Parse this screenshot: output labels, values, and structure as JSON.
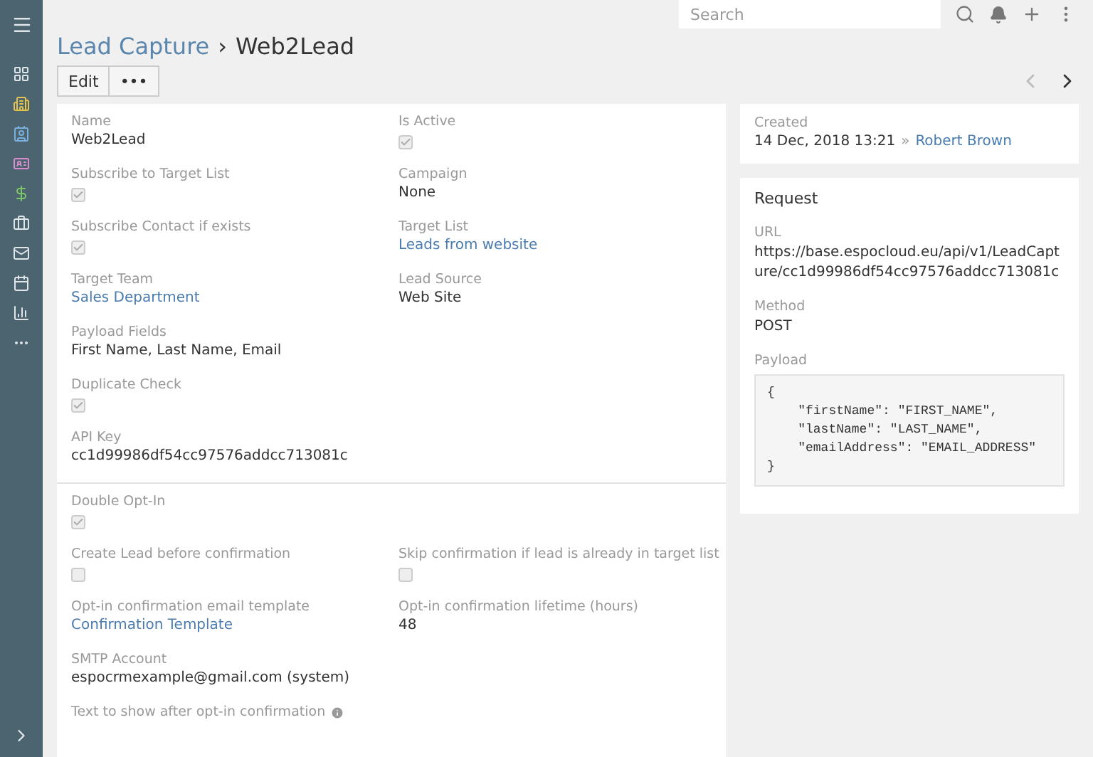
{
  "search": {
    "placeholder": "Search"
  },
  "breadcrumb": {
    "parent": "Lead Capture",
    "separator": "›",
    "current": "Web2Lead"
  },
  "actions": {
    "edit": "Edit",
    "more": "•••"
  },
  "main": {
    "sections": [
      {
        "rows": [
          {
            "fields": [
              {
                "label": "Name",
                "kind": "text",
                "value": "Web2Lead"
              },
              {
                "label": "Is Active",
                "kind": "checkbox",
                "checked": true
              }
            ]
          },
          {
            "fields": [
              {
                "label": "Subscribe to Target List",
                "kind": "checkbox",
                "checked": true
              },
              {
                "label": "Campaign",
                "kind": "text",
                "value": "None"
              }
            ]
          },
          {
            "fields": [
              {
                "label": "Subscribe Contact if exists",
                "kind": "checkbox",
                "checked": true
              },
              {
                "label": "Target List",
                "kind": "link",
                "value": "Leads from website"
              }
            ]
          },
          {
            "fields": [
              {
                "label": "Target Team",
                "kind": "link",
                "value": "Sales Department"
              },
              {
                "label": "Lead Source",
                "kind": "text",
                "value": "Web Site"
              }
            ]
          },
          {
            "fields": [
              {
                "label": "Payload Fields",
                "kind": "text",
                "value": "First Name, Last Name, Email"
              }
            ]
          },
          {
            "fields": [
              {
                "label": "Duplicate Check",
                "kind": "checkbox",
                "checked": true
              }
            ]
          },
          {
            "fields": [
              {
                "label": "API Key",
                "kind": "text",
                "value": "cc1d99986df54cc97576addcc713081c"
              }
            ]
          }
        ]
      },
      {
        "rows": [
          {
            "fields": [
              {
                "label": "Double Opt-In",
                "kind": "checkbox",
                "checked": true
              }
            ]
          },
          {
            "fields": [
              {
                "label": "Create Lead before confirmation",
                "kind": "checkbox",
                "checked": false
              },
              {
                "label": "Skip confirmation if lead is already in target list",
                "kind": "checkbox",
                "checked": false
              }
            ]
          },
          {
            "fields": [
              {
                "label": "Opt-in confirmation email template",
                "kind": "link",
                "value": "Confirmation Template"
              },
              {
                "label": "Opt-in confirmation lifetime (hours)",
                "kind": "text",
                "value": "48"
              }
            ]
          },
          {
            "fields": [
              {
                "label": "SMTP Account",
                "kind": "text",
                "value": "espocrmexample@gmail.com (system)"
              }
            ]
          },
          {
            "fields": [
              {
                "label": "Text to show after opt-in confirmation",
                "kind": "label_info"
              }
            ]
          }
        ]
      }
    ]
  },
  "created": {
    "label": "Created",
    "date": "14 Dec, 2018 13:21",
    "separator": "»",
    "user": "Robert Brown"
  },
  "request": {
    "title": "Request",
    "fields": [
      {
        "label": "URL",
        "kind": "text",
        "value": "https://base.espocloud.eu/api/v1/LeadCapture/cc1d99986df54cc97576addcc713081c"
      },
      {
        "label": "Method",
        "kind": "text",
        "value": "POST"
      },
      {
        "label": "Payload",
        "kind": "code",
        "value": "{\n    \"firstName\": \"FIRST_NAME\",\n    \"lastName\": \"LAST_NAME\",\n    \"emailAddress\": \"EMAIL_ADDRESS\"\n}"
      }
    ]
  }
}
